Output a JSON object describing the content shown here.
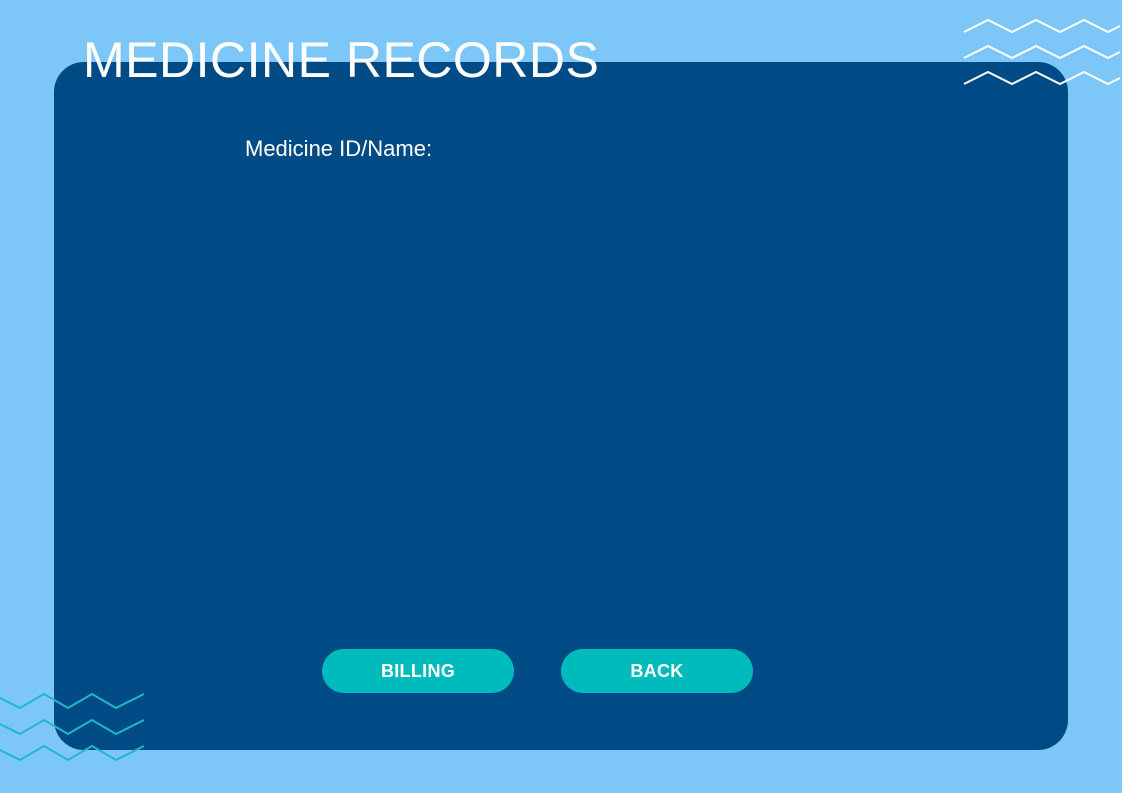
{
  "page": {
    "title": "MEDICINE RECORDS"
  },
  "form": {
    "medicine_label": "Medicine ID/Name:"
  },
  "buttons": {
    "billing_label": "BILLING",
    "back_label": "BACK"
  },
  "icons": {
    "top_right_decoration": "zigzag-lines",
    "bottom_left_decoration": "zigzag-lines"
  },
  "colors": {
    "background": "#7dc7f8",
    "panel": "#004b86",
    "button": "#00bbbb",
    "zigzag_top": "#ffffff",
    "zigzag_bottom": "#1fb8c9",
    "text": "#ffffff"
  }
}
